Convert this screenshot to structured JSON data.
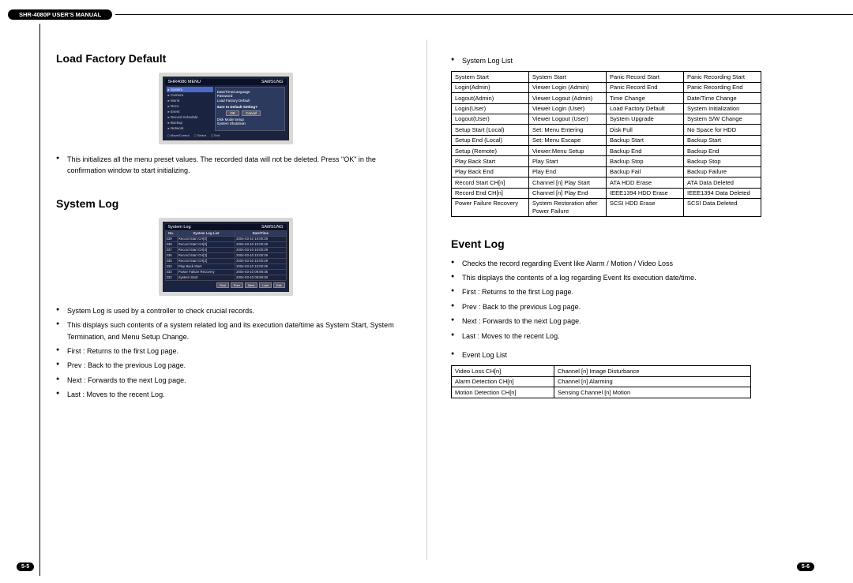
{
  "header": "SHR-4080P USER'S MANUAL",
  "page_left_num": "5-5",
  "page_right_num": "5-6",
  "left": {
    "section1": {
      "title": "Load Factory Default",
      "fig": {
        "title": "SHR4080 MENU",
        "menu": [
          "System",
          "Camera",
          "Monit",
          "Reco",
          "Event",
          "Record Schedule",
          "Backup",
          "Network"
        ],
        "dialog_items": [
          "Date/Time/Language",
          "Password",
          "Load Factory Default"
        ],
        "confirm": "Sure to Default Setting?",
        "btn_ok": "OK",
        "btn_cancel": "Cancel",
        "extra": [
          "Disk Mode Setup",
          "System Shutdown"
        ],
        "footer": [
          "Move/Control",
          "Select",
          "Exit"
        ]
      },
      "bullets": [
        "This initializes all the menu preset values.  The recorded data will not be deleted. Press \"OK\" in the confirmation window to start initializing."
      ]
    },
    "section2": {
      "title": "System Log",
      "fig": {
        "title": "System Log",
        "cols": [
          "No.",
          "System Log List",
          "Date/Time"
        ],
        "rows": [
          [
            "339",
            "Record Start CH[0]",
            "2004-03-10 10:00:29"
          ],
          [
            "338",
            "Record Start CH[0]",
            "2004-03-10 10:00:29"
          ],
          [
            "337",
            "Record Start CH[4]",
            "2004-03-10 10:00:29"
          ],
          [
            "336",
            "Record Start CH[3]",
            "2004-03-10 10:00:29"
          ],
          [
            "335",
            "Record Start CH[2]",
            "2004-03-10 10:00:29"
          ],
          [
            "334",
            "Play Back Start",
            "2004-03-10 10:00:29"
          ],
          [
            "333",
            "Power Failure Recovery",
            "2004-03-10 09:59:36"
          ],
          [
            "332",
            "System Start",
            "2004-03-10 09:59:30"
          ]
        ],
        "btns": [
          "First",
          "Prev",
          "Next",
          "Last",
          "Exit"
        ]
      },
      "bullets": [
        "System Log is used by a controller to check crucial records.",
        "This displays such contents of a system related log and its execution date/time as System Start, System Termination, and Menu Setup Change.",
        "First  : Returns to the first Log page.",
        "Prev   : Back to the previous Log page.",
        "Next   : Forwards to the next Log page.",
        "Last   : Moves to the recent Log."
      ]
    }
  },
  "right": {
    "syslog_label": "System Log List",
    "syslog_table": [
      [
        "System Start",
        "System Start",
        "Panic Record Start",
        "Panic Recording Start"
      ],
      [
        "Login(Admin)",
        "Viewer Login (Admin)",
        "Panic Record End",
        "Panic Recording End"
      ],
      [
        "Logout(Admin)",
        "Viewer Logout (Admin)",
        "Time Change",
        "Date/Time Change"
      ],
      [
        "Login(User)",
        "Viewer Login (User)",
        "Load Factory Default",
        "System Initialization"
      ],
      [
        "Logout(User)",
        "Viewer Logout (User)",
        "System Upgrade",
        "System S/W Change"
      ],
      [
        "Setup Start (Local)",
        "Set: Menu Entering",
        "Disk Full",
        "No Space for HDD"
      ],
      [
        "Setup End (Local)",
        "Set: Menu Escape",
        "Backup Start",
        "Backup Start"
      ],
      [
        "Setup (Remote)",
        "Viewer:Menu Setup",
        "Backup End",
        "Backup End"
      ],
      [
        "Play Back Start",
        "Play Start",
        "Backup Stop",
        "Backup Stop"
      ],
      [
        "Play Back End",
        "Play End",
        "Backup Fail",
        "Backup Failure"
      ],
      [
        "Record Start CH[n]",
        "Channel [n] Play Start",
        "ATA HDD Erase",
        "ATA Data Deleted"
      ],
      [
        "Record End CH[n]",
        "Channel [n] Play End",
        "IEEE1394 HDD Erase",
        "IEEE1394 Data Deleted"
      ],
      [
        "Power Failure Recovery",
        "System Restoration after Power Failure",
        "SCSI HDD Erase",
        "SCSI Data Deleted"
      ]
    ],
    "eventlog": {
      "title": "Event Log",
      "bullets": [
        "Checks the record regarding Event like Alarm / Motion / Video Loss",
        "This displays the contents of a log regarding Event Its execution date/time.",
        "First  : Returns to the first Log page.",
        "Prev   : Back to the previous Log page.",
        "Next   : Forwards to the next Log page.",
        "Last   : Moves to the recent Log."
      ],
      "list_label": "Event Log List",
      "table": [
        [
          "Video Loss CH[n]",
          "Channel [n] Image Disturbance"
        ],
        [
          "Alarm Detection CH[n]",
          "Channel [n] Alarming"
        ],
        [
          "Motion Detection CH[n]",
          "Sensing Channel [n] Motion"
        ]
      ]
    }
  }
}
